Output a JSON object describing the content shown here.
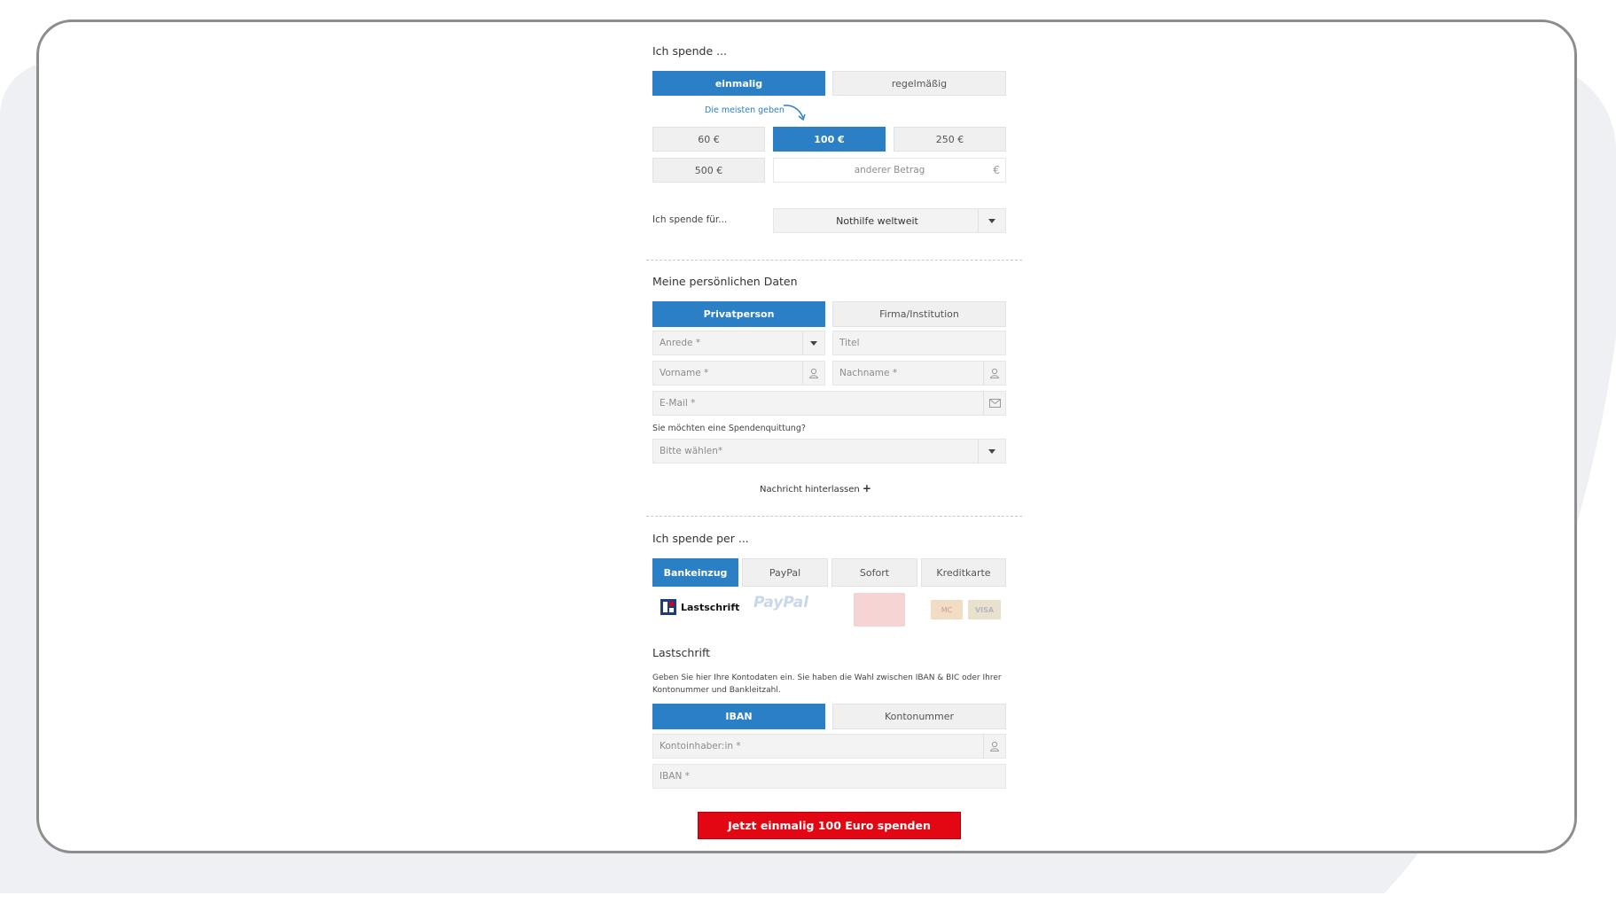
{
  "donation": {
    "heading": "Ich spende ...",
    "frequency": {
      "once": "einmalig",
      "recurring": "regelmäßig",
      "selected": "einmalig"
    },
    "hint": "Die meisten geben",
    "amounts": [
      "60 €",
      "100 €",
      "250 €",
      "500 €"
    ],
    "selected_amount": "100 €",
    "other_amount_placeholder": "anderer Betrag",
    "currency_symbol": "€",
    "purpose_label": "Ich spende für...",
    "purpose_value": "Nothilfe weltweit"
  },
  "personal": {
    "heading": "Meine persönlichen Daten",
    "type_private": "Privatperson",
    "type_company": "Firma/Institution",
    "selected_type": "Privatperson",
    "salutation_placeholder": "Anrede *",
    "title_placeholder": "Titel",
    "firstname_placeholder": "Vorname *",
    "lastname_placeholder": "Nachname *",
    "email_placeholder": "E-Mail *",
    "receipt_question": "Sie möchten eine Spendenquittung?",
    "receipt_placeholder": "Bitte wählen*",
    "message_link": "Nachricht hinterlassen",
    "message_plus": "+"
  },
  "payment": {
    "heading": "Ich spende per ...",
    "methods": [
      "Bankeinzug",
      "PayPal",
      "Sofort",
      "Kreditkarte"
    ],
    "selected_method": "Bankeinzug",
    "logos": {
      "lastschrift": "Lastschrift",
      "paypal": "PayPal",
      "mastercard": "MC",
      "visa": "VISA"
    }
  },
  "debit": {
    "heading": "Lastschrift",
    "description": "Geben Sie hier Ihre Kontodaten ein. Sie haben die Wahl zwischen IBAN & BIC oder Ihrer Kontonummer und Bankleitzahl.",
    "tab_iban": "IBAN",
    "tab_account": "Kontonummer",
    "selected_tab": "IBAN",
    "holder_placeholder": "Kontoinhaber:in *",
    "iban_placeholder": "IBAN *"
  },
  "submit_label": "Jetzt einmalig 100 Euro spenden",
  "colors": {
    "accent": "#2a7fc5",
    "cta": "#e30613",
    "frame_border": "#8d8d8d",
    "background": "#eef0f3"
  }
}
